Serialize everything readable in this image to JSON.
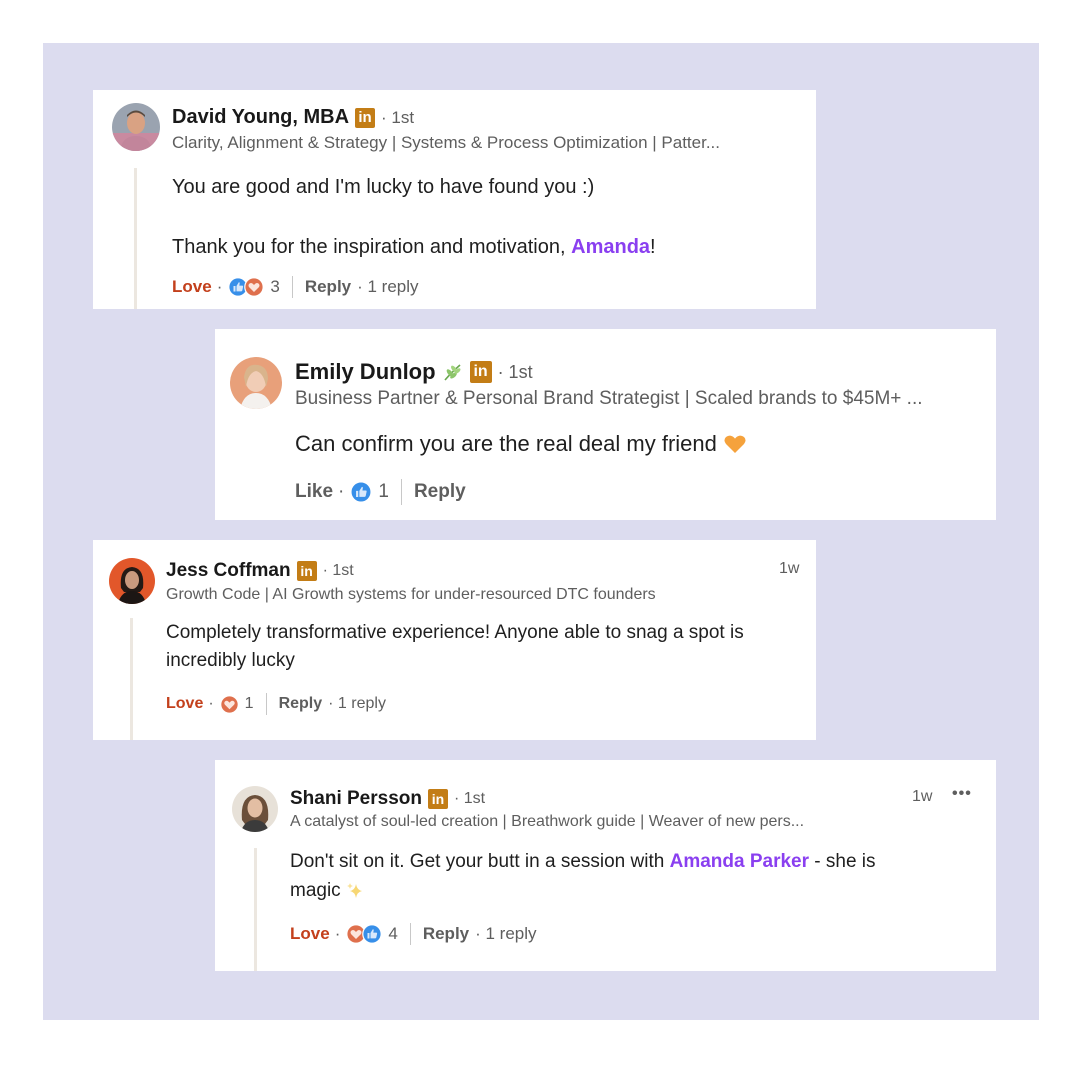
{
  "colors": {
    "backdrop": "#dcdcef",
    "love": "#c3401c",
    "mention": "#8a3ff0",
    "linkedin_badge": "#c37d16",
    "like_blue": "#378fe9",
    "heart_red": "#df704d"
  },
  "comments": [
    {
      "author": "David Young, MBA",
      "badges": [
        "linkedin-icon"
      ],
      "degree": "· 1st",
      "headline": "Clarity, Alignment & Strategy | Systems & Process Optimization | Patter...",
      "body": [
        {
          "text": "You are good and I'm lucky to have found you :)"
        },
        {
          "before": "Thank you for the inspiration and motivation, ",
          "mention": "Amanda",
          "after": "!"
        }
      ],
      "reaction_label": "Love",
      "reaction_icons": [
        "like-icon",
        "heart-icon"
      ],
      "reaction_count": "3",
      "reply_label": "Reply",
      "replies": "· 1 reply"
    },
    {
      "author": "Emily Dunlop",
      "badges": [
        "leaf-icon",
        "linkedin-icon"
      ],
      "degree": "· 1st",
      "headline": "Business Partner & Personal Brand Strategist | Scaled brands to $45M+ ...",
      "body": [
        {
          "text": "Can confirm you are the real deal my friend",
          "emoji": "orange-heart-icon"
        }
      ],
      "reaction_label": "Like",
      "reaction_icons": [
        "like-icon"
      ],
      "reaction_count": "1",
      "reply_label": "Reply"
    },
    {
      "author": "Jess Coffman",
      "badges": [
        "linkedin-icon"
      ],
      "degree": "· 1st",
      "timestamp": "1w",
      "headline": "Growth Code | AI Growth systems for under-resourced DTC founders",
      "body": [
        {
          "text": "Completely transformative experience! Anyone able to snag a spot is"
        },
        {
          "text": "incredibly lucky"
        }
      ],
      "reaction_label": "Love",
      "reaction_icons": [
        "heart-icon"
      ],
      "reaction_count": "1",
      "reply_label": "Reply",
      "replies": "· 1 reply"
    },
    {
      "author": "Shani Persson",
      "badges": [
        "linkedin-icon"
      ],
      "degree": "· 1st",
      "timestamp": "1w",
      "more": "•••",
      "headline": "A catalyst of soul-led creation | Breathwork guide | Weaver of new pers...",
      "body": [
        {
          "before": "Don't sit on it. Get your butt in a session with ",
          "mention": "Amanda Parker",
          "after": " - she is"
        },
        {
          "text": "magic",
          "emoji": "sparkles-icon"
        }
      ],
      "reaction_label": "Love",
      "reaction_icons": [
        "heart-icon",
        "like-icon"
      ],
      "reaction_count": "4",
      "reply_label": "Reply",
      "replies": "· 1 reply"
    }
  ],
  "badge_text": "in"
}
